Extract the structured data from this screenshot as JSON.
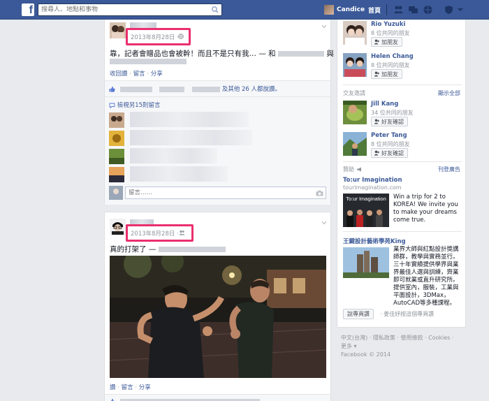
{
  "topbar": {
    "search_placeholder": "搜尋人、地點和事物",
    "profile_name": "Candice",
    "home_label": "首頁"
  },
  "story1": {
    "timestamp": "2013年8月28日 ·",
    "text_start": "靠，記者會贈品也會被幹！而且不是只有我… — 和",
    "text_end": "與",
    "action_links": [
      "收回讚",
      "留言",
      "分享"
    ],
    "likes_suffix": "及其他 26 人都說讚。",
    "view_comments": "檢視另15則留言",
    "comment_placeholder": "留言……"
  },
  "story2": {
    "timestamp": "2013年8月28日 ·",
    "text": "真的打架了 —",
    "action_links": [
      "讚",
      "留言",
      "分享"
    ]
  },
  "sidebar": {
    "people_you_may_know": [
      {
        "name": "Rio Yuzuki",
        "mutual": "8 位共同的朋友",
        "button": "加朋友"
      },
      {
        "name": "Helen Chang",
        "mutual": "8 位共同的朋友",
        "button": "加朋友"
      }
    ],
    "friend_requests": {
      "title": "交友邀請",
      "see_all": "顯示全部",
      "items": [
        {
          "name": "Jill Kang",
          "mutual": "34 位共同的朋友",
          "button": "好友確認"
        },
        {
          "name": "Peter Tang",
          "mutual": "8 位共同的朋友",
          "button": "好友確認"
        }
      ]
    },
    "ads": {
      "title": "贊助",
      "create_ad": "刊登廣告",
      "ad1": {
        "title": "To:ur Imagination",
        "domain": "tourimagination.com",
        "image_text": "To:ur Imagination",
        "body": "Win a trip for 2 to KOREA! We invite you to make your dreams come true."
      },
      "ad2": {
        "title": "王鍵設計藝術學苑King",
        "body": "業界大師與紅點設計獎講師群，教學與實務並行。三十年實績提供學界與業界最佳人選與訓練，齊業即可就業或直升研究所。提供室內，服裝，工業與平面設計，3DMax，AutoCAD等多種課程。",
        "button": "說專頁讚",
        "like_text": "· 姜佳妤按這個專頁讚"
      }
    }
  },
  "footer": {
    "line1": "中文(台灣) · 隱私政策 · 使用條款 · Cookies ·",
    "line2": "更多 ▾",
    "line3": "Facebook © 2014"
  },
  "colors": {
    "brand_blue": "#3b5998",
    "highlight_pink": "#ea2f6f",
    "background": "#e9eaed"
  },
  "icons": [
    "facebook-logo-icon",
    "search-icon",
    "friend-requests-icon",
    "messages-icon",
    "notifications-icon",
    "privacy-icon",
    "settings-dropdown-icon",
    "globe-icon",
    "friends-audience-icon",
    "chevron-down-icon",
    "like-thumb-icon",
    "comment-bubble-icon",
    "camera-icon",
    "add-friend-icon",
    "megaphone-icon"
  ]
}
